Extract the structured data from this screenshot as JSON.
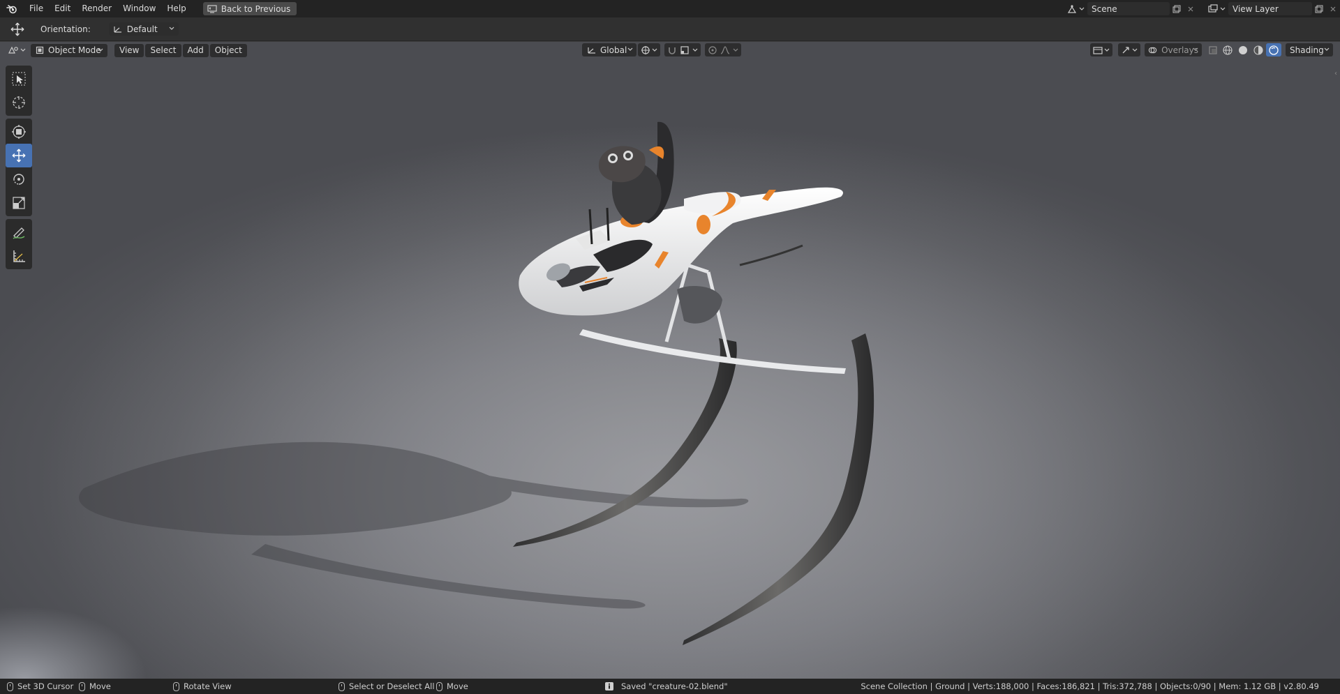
{
  "topbar": {
    "menus": [
      "File",
      "Edit",
      "Render",
      "Window",
      "Help"
    ],
    "back_button": "Back to Previous",
    "scene_name": "Scene",
    "view_layer": "View Layer"
  },
  "tool_settings": {
    "orientation_label": "Orientation:",
    "orientation_value": "Default"
  },
  "viewport_header": {
    "mode": "Object Mode",
    "menus": [
      "View",
      "Select",
      "Add",
      "Object"
    ],
    "transform_orientation": "Global",
    "overlays": "Overlays",
    "shading": "Shading"
  },
  "status": {
    "left_items": [
      "Set 3D Cursor",
      "Move",
      "Rotate View",
      "Select or Deselect All",
      "Move"
    ],
    "saved_message": "Saved \"creature-02.blend\"",
    "scene_stats": "Scene Collection | Ground | Verts:188,000 | Faces:186,821 | Tris:372,788 | Objects:0/90 | Mem: 1.12 GB | v2.80.49"
  },
  "colors": {
    "accent": "#4772b3",
    "topbar_bg": "#232323",
    "header_bg": "#303030",
    "vehicle_orange": "#e8842c"
  }
}
